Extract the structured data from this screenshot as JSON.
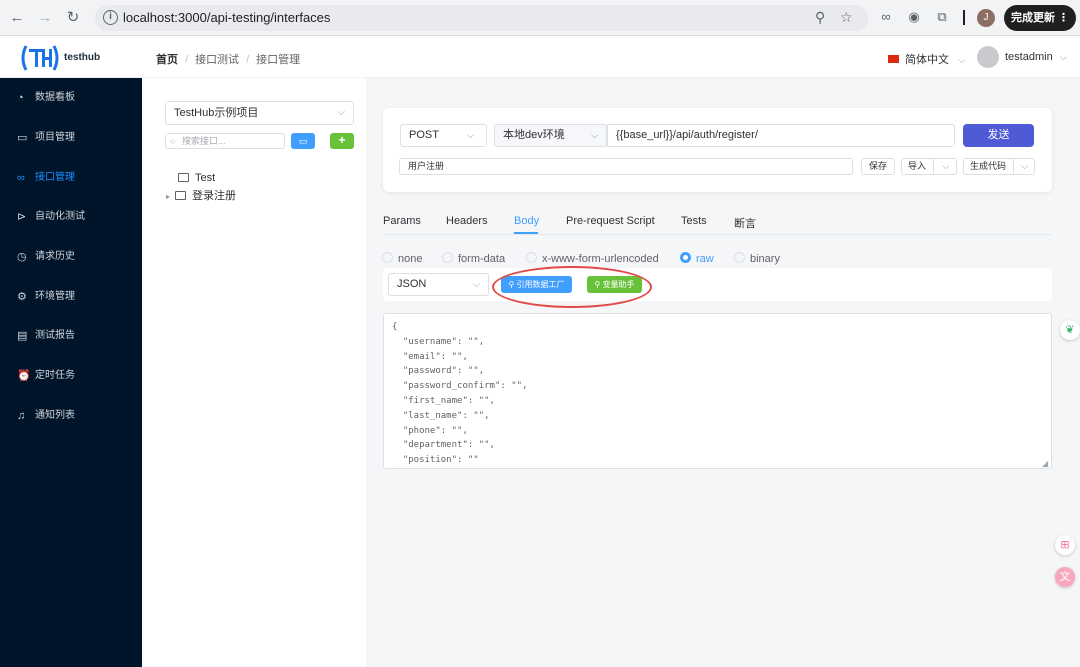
{
  "browser": {
    "url": "localhost:3000/api-testing/interfaces",
    "update_label": "完成更新",
    "profile_initial": "J"
  },
  "header": {
    "logo_text": "testhub",
    "breadcrumb": [
      "首页",
      "接口测试",
      "接口管理"
    ],
    "language": "简体中文",
    "username": "testadmin"
  },
  "sidebar": {
    "items": [
      {
        "label": "数据看板",
        "icon": "dashboard-icon"
      },
      {
        "label": "项目管理",
        "icon": "folder-icon"
      },
      {
        "label": "接口管理",
        "icon": "link-icon",
        "active": true
      },
      {
        "label": "自动化测试",
        "icon": "play-icon"
      },
      {
        "label": "请求历史",
        "icon": "history-icon"
      },
      {
        "label": "环境管理",
        "icon": "gear-icon"
      },
      {
        "label": "测试报告",
        "icon": "report-icon"
      },
      {
        "label": "定时任务",
        "icon": "alarm-icon"
      },
      {
        "label": "通知列表",
        "icon": "bell-icon"
      }
    ]
  },
  "tree": {
    "project": "TestHub示例项目",
    "search_placeholder": "搜索接口...",
    "nodes": [
      {
        "label": "Test"
      },
      {
        "label": "登录注册"
      }
    ]
  },
  "request": {
    "method": "POST",
    "environment": "本地dev环境",
    "url": "{{base_url}}/api/auth/register/",
    "send_label": "发送",
    "name": "用户注册",
    "save_label": "保存",
    "import_label": "导入",
    "generate_label": "生成代码"
  },
  "tabs": [
    "Params",
    "Headers",
    "Body",
    "Pre-request Script",
    "Tests",
    "断言"
  ],
  "active_tab": "Body",
  "body_types": [
    "none",
    "form-data",
    "x-www-form-urlencoded",
    "raw",
    "binary"
  ],
  "selected_body_type": "raw",
  "body": {
    "format": "JSON",
    "ref_data_label": "引用数据工厂",
    "var_helper_label": "变量助手",
    "code": "{\n  \"username\": \"\",\n  \"email\": \"\",\n  \"password\": \"\",\n  \"password_confirm\": \"\",\n  \"first_name\": \"\",\n  \"last_name\": \"\",\n  \"phone\": \"\",\n  \"department\": \"\",\n  \"position\": \"\""
  },
  "colors": {
    "sidebar_bg": "#001529",
    "accent": "#409eff",
    "send_button": "#4f5bd5",
    "success": "#67c23a",
    "annotation_circle": "#e24a4a"
  }
}
